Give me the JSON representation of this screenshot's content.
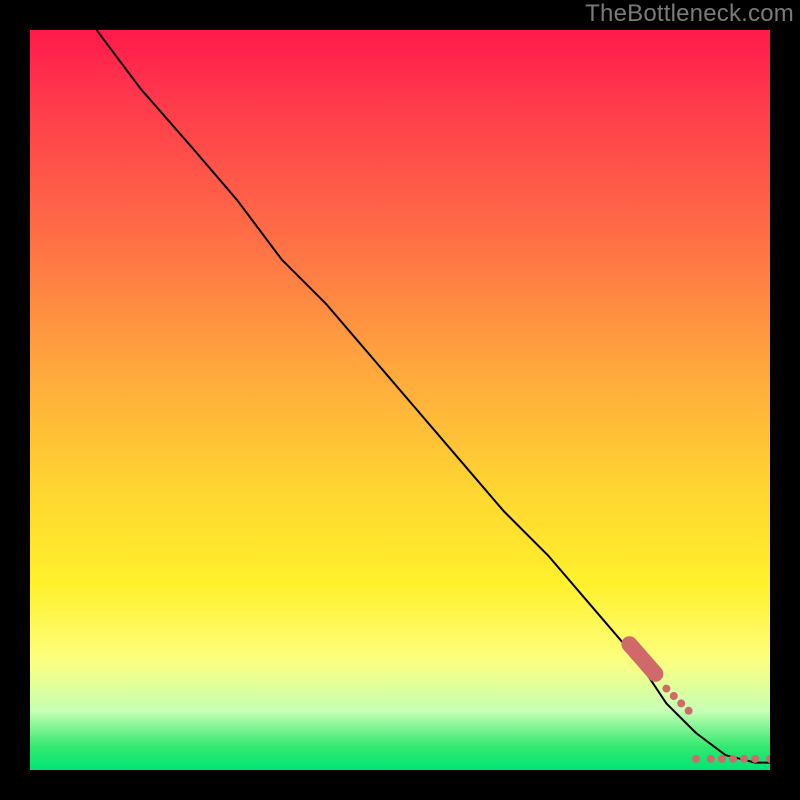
{
  "watermark": "TheBottleneck.com",
  "chart_data": {
    "type": "line",
    "title": "",
    "xlabel": "",
    "ylabel": "",
    "xlim": [
      0,
      100
    ],
    "ylim": [
      0,
      100
    ],
    "grid": false,
    "legend": false,
    "series": [
      {
        "name": "curve",
        "x": [
          9,
          15,
          22,
          28,
          34,
          40,
          46,
          52,
          58,
          64,
          70,
          76,
          82,
          86,
          90,
          94,
          98,
          100
        ],
        "y": [
          100,
          92,
          84,
          77,
          69,
          63,
          56,
          49,
          42,
          35,
          29,
          22,
          15,
          9,
          5,
          2,
          1,
          1
        ]
      }
    ],
    "scatter": {
      "name": "points",
      "x": [
        81,
        82,
        82.5,
        83.5,
        84,
        84.5,
        86,
        87,
        88,
        89,
        90,
        92,
        93.5,
        95,
        96.5,
        98,
        100
      ],
      "y": [
        17,
        15.5,
        15,
        14,
        13.5,
        13,
        11,
        10,
        9,
        8,
        1.5,
        1.5,
        1.5,
        1.5,
        1.5,
        1.5,
        1.5
      ],
      "color": "#d06a6a",
      "size": 8
    },
    "pill_segment": {
      "x1": 81,
      "y1": 17,
      "x2": 84.5,
      "y2": 13,
      "color": "#d06a6a",
      "width": 16
    }
  }
}
